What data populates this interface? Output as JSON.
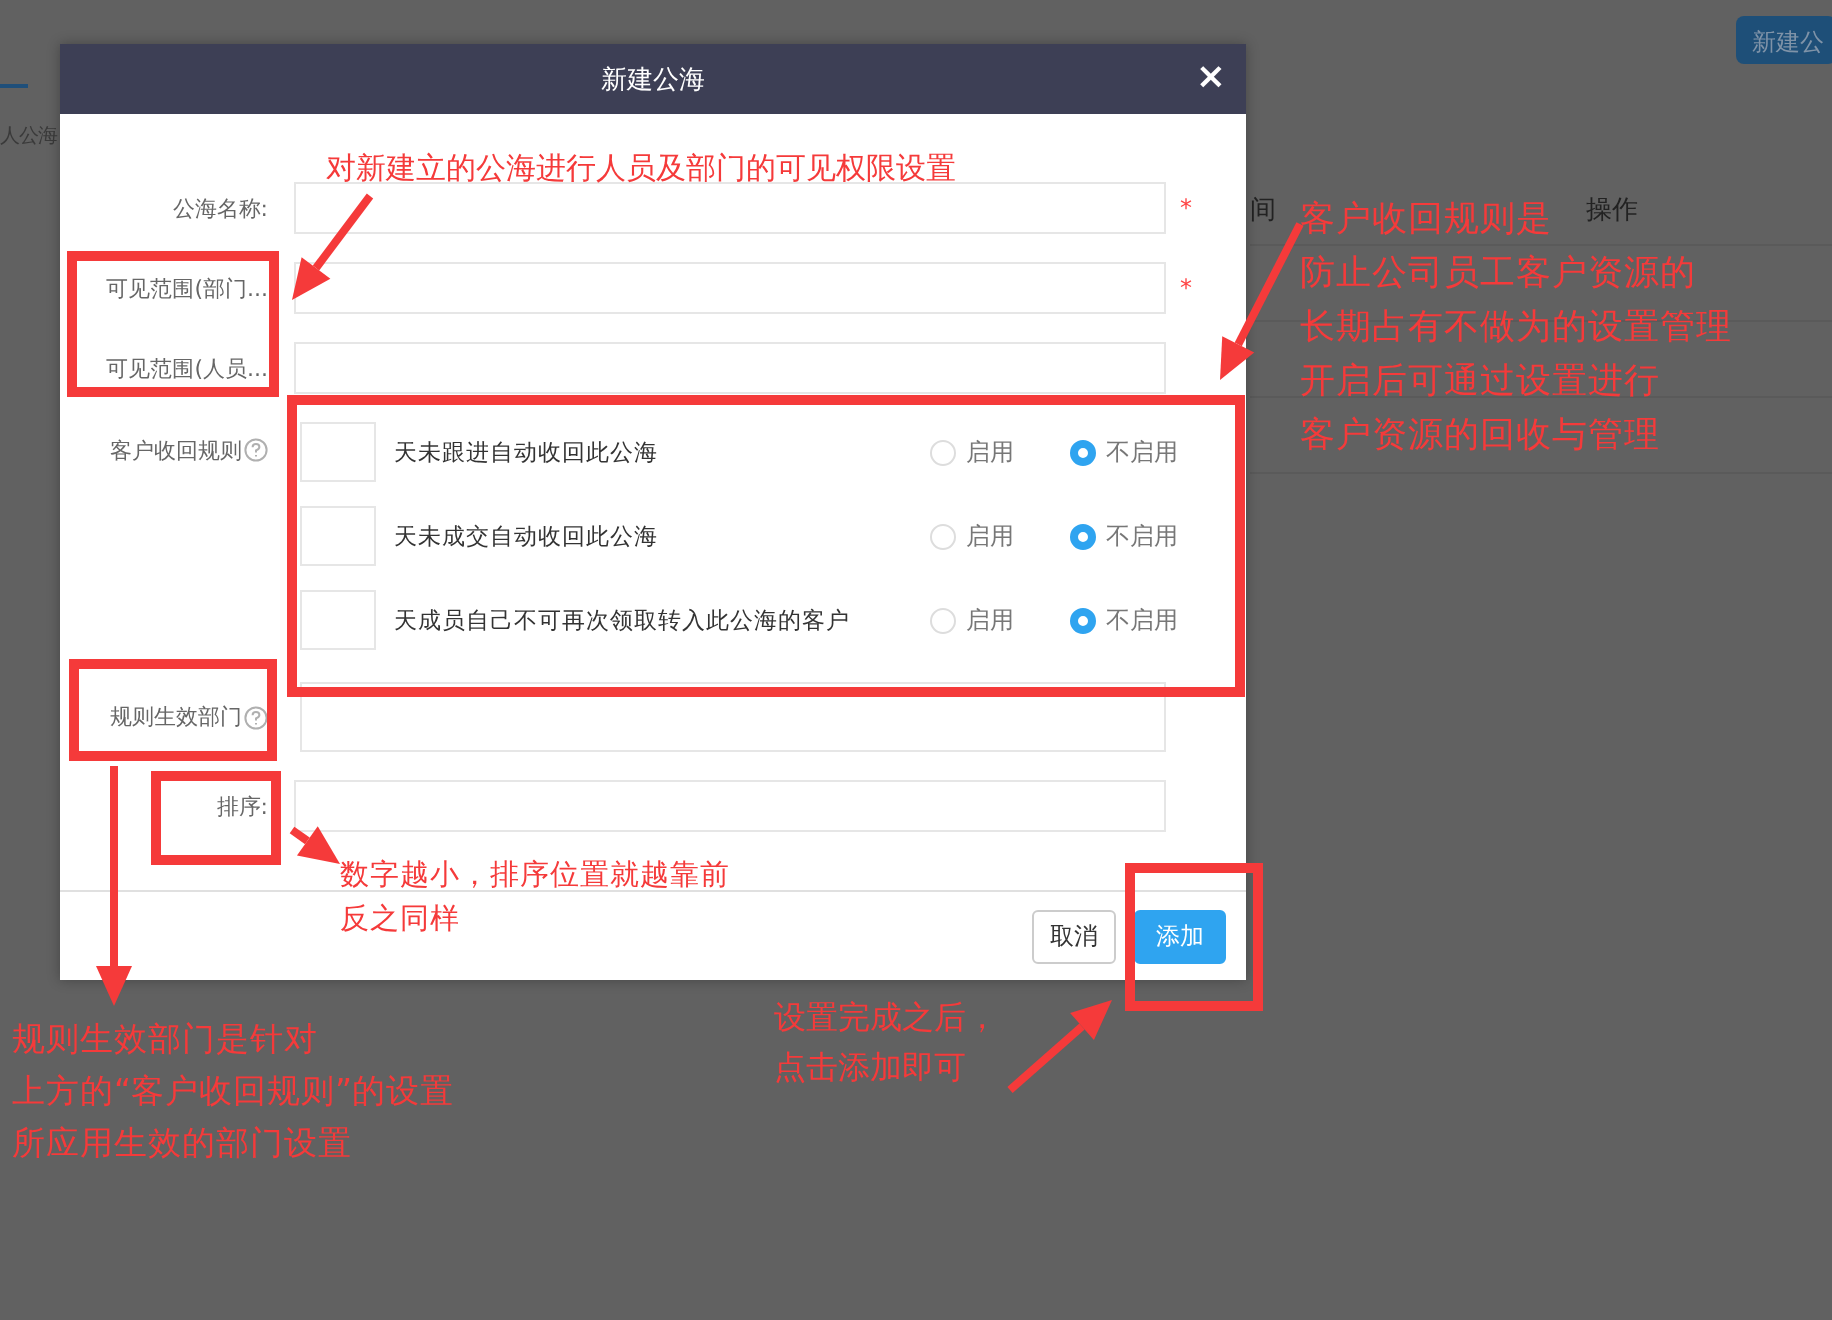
{
  "background_page": {
    "tab_label": "人公海",
    "new_button": "新建公",
    "table_headers": [
      {
        "kind": "cut",
        "label": "间"
      },
      {
        "kind": "action",
        "label": "操作"
      }
    ]
  },
  "modal": {
    "title": "新建公海",
    "close": "×",
    "fields": [
      {
        "kind": "text",
        "label": "公海名称:",
        "required_mark": "*"
      },
      {
        "kind": "text",
        "label": "可见范围(部门...",
        "required_mark": "*"
      },
      {
        "kind": "text",
        "label": "可见范围(人员..."
      },
      {
        "kind": "rules",
        "label": "客户收回规则",
        "help": true,
        "rules": [
          {
            "text": "天未跟进自动收回此公海",
            "options": [
              {
                "label": "启用",
                "selected": false
              },
              {
                "label": "不启用",
                "selected": true
              }
            ]
          },
          {
            "text": "天未成交自动收回此公海",
            "options": [
              {
                "label": "启用",
                "selected": false
              },
              {
                "label": "不启用",
                "selected": true
              }
            ]
          },
          {
            "text": "天成员自己不可再次领取转入此公海的客户",
            "options": [
              {
                "label": "启用",
                "selected": false
              },
              {
                "label": "不启用",
                "selected": true
              }
            ]
          }
        ]
      },
      {
        "kind": "tall",
        "label": "规则生效部门",
        "help": true
      },
      {
        "kind": "text",
        "label": "排序:"
      }
    ],
    "buttons": [
      {
        "kind": "default",
        "label": "取消"
      },
      {
        "kind": "primary",
        "label": "添加"
      }
    ]
  },
  "annotations": [
    {
      "lines": [
        "对新建立的公海进行人员及部门的可见权限设置"
      ]
    },
    {
      "lines": [
        "客户收回规则是",
        "防止公司员工客户资源的",
        "长期占有不做为的设置管理",
        "开启后可通过设置进行",
        "客户资源的回收与管理"
      ]
    },
    {
      "lines": [
        "数字越小，排序位置就越靠前",
        "反之同样"
      ]
    },
    {
      "lines": [
        "规则生效部门是针对",
        "上方的“客户收回规则”的设置",
        "所应用生效的部门设置"
      ]
    },
    {
      "lines": [
        "设置完成之后，",
        "点击添加即可"
      ]
    }
  ]
}
